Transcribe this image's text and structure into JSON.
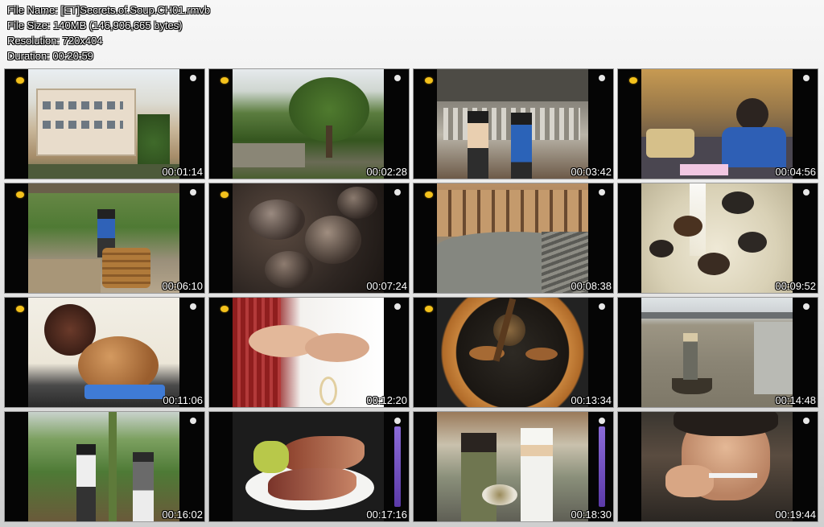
{
  "info": {
    "file_name": "File Name: [ET]Secrets.of.Soup.CH01.rmvb",
    "file_size": "File Size: 140MB (146,906,665 bytes)",
    "resolution": "Resolution: 720x404",
    "duration": "Duration: 00:20:59"
  },
  "thumbnails": [
    {
      "timestamp": "00:01:14",
      "scene": "building-with-palm-trees"
    },
    {
      "timestamp": "00:02:28",
      "scene": "large-tree-village"
    },
    {
      "timestamp": "00:03:42",
      "scene": "two-people-at-pigeon-farm"
    },
    {
      "timestamp": "00:04:56",
      "scene": "woman-eating-at-table"
    },
    {
      "timestamp": "00:06:10",
      "scene": "man-with-wooden-barrel"
    },
    {
      "timestamp": "00:07:24",
      "scene": "snails-closeup"
    },
    {
      "timestamp": "00:08:38",
      "scene": "round-earth-building-courtyard"
    },
    {
      "timestamp": "00:09:52",
      "scene": "soup-with-snails"
    },
    {
      "timestamp": "00:11:06",
      "scene": "clay-soup-pot-on-stove"
    },
    {
      "timestamp": "00:12:20",
      "scene": "hands-holding-food"
    },
    {
      "timestamp": "00:13:34",
      "scene": "soup-pot-from-above"
    },
    {
      "timestamp": "00:14:48",
      "scene": "fisherman-on-boat"
    },
    {
      "timestamp": "00:16:02",
      "scene": "two-people-in-banana-grove"
    },
    {
      "timestamp": "00:17:16",
      "scene": "banana-flowers-on-plate"
    },
    {
      "timestamp": "00:18:30",
      "scene": "host-with-chef"
    },
    {
      "timestamp": "00:19:44",
      "scene": "woman-tasting-soup"
    }
  ]
}
